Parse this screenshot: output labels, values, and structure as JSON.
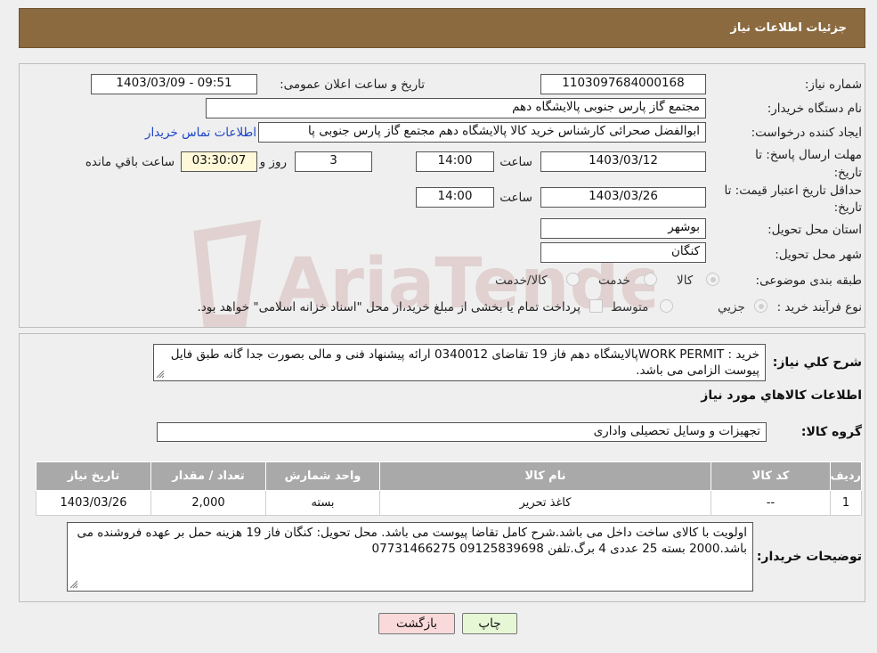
{
  "header": {
    "title": "جزئیات اطلاعات نیاز"
  },
  "fields": {
    "need_number_label": "شماره نیاز:",
    "need_number": "1103097684000168",
    "announce_label": "تاریخ و ساعت اعلان عمومی:",
    "announce_value": "1403/03/09 - 09:51",
    "buyer_org_label": "نام دستگاه خریدار:",
    "buyer_org": "مجتمع گاز پارس جنوبی  پالایشگاه دهم",
    "requester_label": "ایجاد کننده درخواست:",
    "requester": "ابوالفضل صحرائی کارشناس خرید کالا پالایشگاه دهم مجتمع گاز پارس جنوبی  پا",
    "contact_link": "اطلاعات تماس خریدار",
    "deadline_label_1": "مهلت ارسال پاسخ: تا",
    "deadline_label_2": "تاریخ:",
    "deadline_date": "1403/03/12",
    "time_label": "ساعت",
    "deadline_time": "14:00",
    "days_value": "3",
    "days_label": "روز و",
    "remaining_time": "03:30:07",
    "remaining_label": "ساعت باقي مانده",
    "validity_label_1": "حداقل تاریخ اعتبار قیمت: تا",
    "validity_label_2": "تاریخ:",
    "validity_date": "1403/03/26",
    "validity_time_label": "ساعت",
    "validity_time": "14:00",
    "province_label": "استان محل تحویل:",
    "province": "بوشهر",
    "city_label": "شهر محل تحویل:",
    "city": "کنگان",
    "category_label": "طبقه بندی موضوعی:",
    "category_options": [
      "کالا",
      "خدمت",
      "کالا/خدمت"
    ],
    "process_label": "نوع فرآیند خرید :",
    "process_options": [
      "جزیي",
      "متوسط"
    ],
    "process_note": "پرداخت تمام یا بخشی از مبلغ خرید،از محل \"اسناد خزانه اسلامی\" خواهد بود."
  },
  "description": {
    "label": "شرح کلي نياز:",
    "text": "خرید : WORK PERMITپالایشگاه دهم فاز 19  تقاضای 0340012 ارائه پیشنهاد فنی و مالی بصورت جدا گانه طبق فایل پیوست الزامی می باشد."
  },
  "goods": {
    "section_title": "اطلاعات کالاهاي مورد نياز",
    "group_label": "گروه کالا:",
    "group_value": "تجهیزات و وسایل تحصیلی واداری",
    "columns": [
      "رديف",
      "کد کالا",
      "نام کالا",
      "واحد شمارش",
      "تعداد / مقدار",
      "تاریخ نیاز"
    ],
    "rows": [
      [
        "1",
        "--",
        "کاغذ تحریر",
        "بسته",
        "2,000",
        "1403/03/26"
      ]
    ]
  },
  "buyer_notes": {
    "label": "توضیحات خریدار:",
    "text": "اولویت با کالای ساخت داخل می باشد.شرح کامل تقاضا پیوست می باشد. محل تحویل: کنگان فاز 19 هزینه حمل بر عهده فروشنده می باشد.2000 بسته 25 عددی 4 برگ.تلفن 09125839698 07731466275"
  },
  "buttons": {
    "print": "چاپ",
    "back": "بازگشت"
  },
  "watermark": {
    "text": "AriaTender.neT"
  },
  "colors": {
    "header_bg": "#8b6a3f",
    "link": "#1a44c4",
    "back_button_bg": "#f9d9d9",
    "print_button_bg": "#e6f7d6"
  }
}
